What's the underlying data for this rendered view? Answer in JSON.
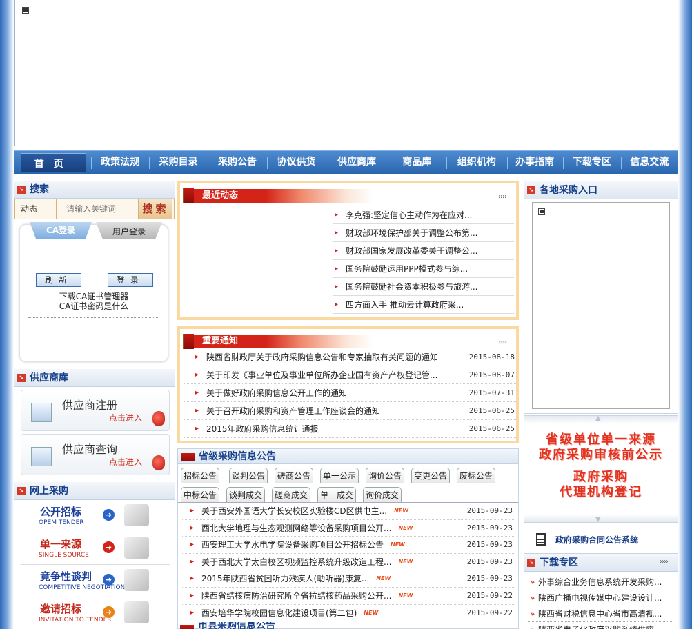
{
  "nav": {
    "home": "首页",
    "items": [
      "政策法规",
      "采购目录",
      "采购公告",
      "协议供货",
      "供应商库",
      "商品库",
      "组织机构",
      "办事指南",
      "下载专区",
      "信息交流"
    ]
  },
  "search": {
    "title": "搜索",
    "category": "动态",
    "placeholder": "请输入关键词",
    "button": "搜索"
  },
  "login": {
    "tab_ca": "CA登录",
    "tab_user": "用户登录",
    "refresh": "刷新",
    "submit": "登录",
    "link1": "下载CA证书管理器",
    "link2": "CA证书密码是什么"
  },
  "supplier": {
    "title": "供应商库",
    "register": "供应商注册",
    "query": "供应商查询",
    "enter": "点击进入"
  },
  "online": {
    "title": "网上采购",
    "items": [
      {
        "cn": "公开招标",
        "en": "OPEM TENDER",
        "color": "#1a3f9a",
        "arrow": "#2a64c8"
      },
      {
        "cn": "单一来源",
        "en": "SINGLE SOURCE",
        "color": "#c4281a",
        "arrow": "#d42318"
      },
      {
        "cn": "竞争性谈判",
        "en": "COMPETITIVE NEGOTIATION",
        "color": "#1a3f9a",
        "arrow": "#2a64c8"
      },
      {
        "cn": "邀请招标",
        "en": "INVITATION TO TENDER",
        "color": "#c4281a",
        "arrow": "#e8831a"
      }
    ]
  },
  "recent": {
    "title": "最近动态",
    "items": [
      "李克强:坚定信心主动作为在应对...",
      "财政部环境保护部关于调整公布第...",
      "财政部国家发展改革委关于调整公...",
      "国务院鼓励运用PPP模式参与综...",
      "国务院鼓励社会资本积极参与旅游...",
      "四方面入手 推动云计算政府采..."
    ]
  },
  "notices": {
    "title": "重要通知",
    "items": [
      {
        "t": "陕西省财政厅关于政府采购信息公告和专家抽取有关问题的通知",
        "d": "2015-08-18"
      },
      {
        "t": "关于印发《事业单位及事业单位所办企业国有资产产权登记管...",
        "d": "2015-08-07"
      },
      {
        "t": "关于做好政府采购信息公开工作的通知",
        "d": "2015-07-31"
      },
      {
        "t": "关于召开政府采购和资产管理工作座谈会的通知",
        "d": "2015-06-25"
      },
      {
        "t": "2015年政府采购信息统计通报",
        "d": "2015-06-25"
      }
    ]
  },
  "province": {
    "title": "省级采购信息公告",
    "tabs_row1": [
      "招标公告",
      "谈判公告",
      "磋商公告",
      "单一公示",
      "询价公告",
      "变更公告",
      "废标公告"
    ],
    "tabs_row2": [
      "中标公告",
      "谈判成交",
      "磋商成交",
      "单一成交",
      "询价成交"
    ],
    "new_tag": "NEW",
    "items": [
      {
        "t": "关于西安外国语大学长安校区实验楼CD区供电主...",
        "d": "2015-09-23"
      },
      {
        "t": "西北大学地理与生态观测网络等设备采购项目公开...",
        "d": "2015-09-23"
      },
      {
        "t": "西安理工大学水电学院设备采购项目公开招标公告",
        "d": "2015-09-23"
      },
      {
        "t": "关于西北大学太白校区视频监控系统升级改造工程...",
        "d": "2015-09-23"
      },
      {
        "t": "2015年陕西省贫困听力残疾人(助听器)康复...",
        "d": "2015-09-23"
      },
      {
        "t": "陕西省结核病防治研究所全省抗结核药品采购公开...",
        "d": "2015-09-22"
      },
      {
        "t": "西安培华学院校园信息化建设项目(第二包)",
        "d": "2015-09-22"
      }
    ]
  },
  "city": {
    "title": "市县采购信息公告"
  },
  "regions": {
    "title": "各地采购入口"
  },
  "banners": {
    "b1_line1": "省级单位单一来源",
    "b1_line2": "政府采购审核前公示",
    "b2_line1": "政府采购",
    "b2_line2": "代理机构登记"
  },
  "contract": {
    "title": "政府采购合同公告系统"
  },
  "download": {
    "title": "下载专区",
    "items": [
      "外事综合业务信息系统开发采购...",
      "陕西广播电视传媒中心建设设计...",
      "陕西省财税信息中心省市高清视...",
      "陕西省电子化政府采购系统供应..."
    ]
  }
}
